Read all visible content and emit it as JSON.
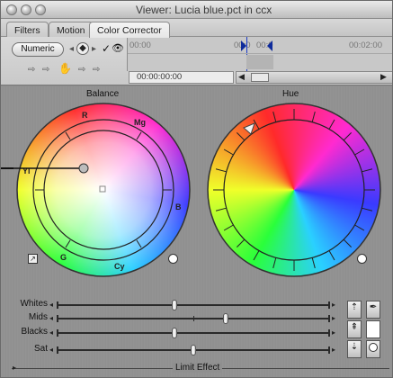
{
  "window": {
    "title": "Viewer: Lucia blue.pct in ccx"
  },
  "tabs": [
    {
      "label": "Filters"
    },
    {
      "label": "Motion"
    },
    {
      "label": "Color Corrector"
    }
  ],
  "controls": {
    "numeric_label": "Numeric",
    "timeline_ticks": [
      "00:00",
      "00:0",
      "00:0",
      "00:02:00"
    ],
    "timecode": "00:00:00:00"
  },
  "main": {
    "balance_label": "Balance",
    "hue_label": "Hue",
    "balance_wheel_labels": {
      "r": "R",
      "mg": "Mg",
      "b": "B",
      "cy": "Cy",
      "g": "G",
      "yl": "Yl"
    },
    "sliders": [
      {
        "label": "Whites",
        "value": 0.43
      },
      {
        "label": "Mids",
        "value": 0.62
      },
      {
        "label": "Blacks",
        "value": 0.43
      },
      {
        "label": "Sat",
        "value": 0.5
      }
    ],
    "limit_effect_label": "Limit Effect"
  },
  "colors": {
    "accent_blue": "#1a3cc8",
    "panel_gray": "#8f8f8f"
  }
}
